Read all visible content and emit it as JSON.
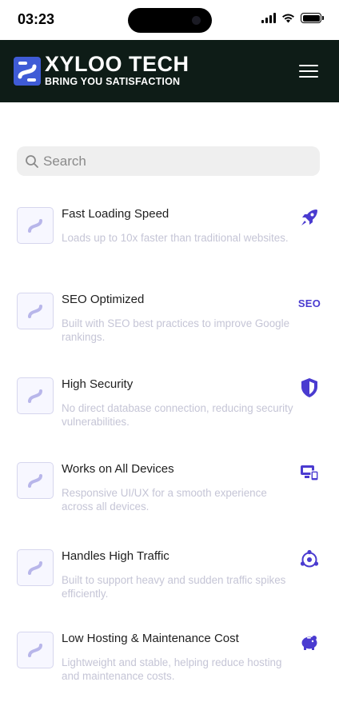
{
  "status_bar": {
    "time": "03:23"
  },
  "header": {
    "brand_name": "XYLOO TECH",
    "tagline": "BRING YOU SATISFACTION"
  },
  "search": {
    "placeholder": "Search"
  },
  "colors": {
    "accent": "#4a3bd0",
    "header_bg": "#0e1c17",
    "description": "#c5c5d6"
  },
  "features": [
    {
      "title": "Fast Loading Speed",
      "description": "Loads up to 10x faster than traditional websites.",
      "icon": "rocket-icon"
    },
    {
      "title": "SEO Optimized",
      "description": "Built with SEO best practices to improve Google rankings.",
      "icon_text": "SEO"
    },
    {
      "title": "High Security",
      "description": "No direct database connection, reducing security vulnerabilities.",
      "icon": "shield-icon"
    },
    {
      "title": "Works on All Devices",
      "description": "Responsive UI/UX for a smooth experience across all devices.",
      "icon": "devices-icon"
    },
    {
      "title": "Handles High Traffic",
      "description": "Built to support heavy and sudden traffic spikes efficiently.",
      "icon": "network-icon"
    },
    {
      "title": "Low Hosting & Maintenance Cost",
      "description": "Lightweight and stable, helping reduce hosting and maintenance costs.",
      "icon": "piggy-bank-icon"
    }
  ]
}
